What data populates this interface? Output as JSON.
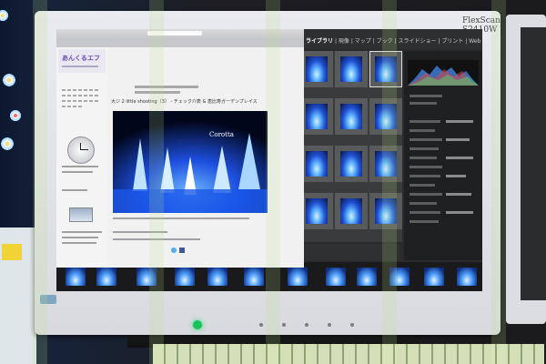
{
  "scene": {
    "monitor_brand": "FlexScan S2410W",
    "lightroom_menu": {
      "active": "ライブラリ",
      "items": [
        "現像",
        "マップ",
        "ブック",
        "スライドショー",
        "プリント",
        "Web"
      ]
    },
    "blog": {
      "site_title": "あんくるエフ",
      "post_title": "大ジ 2 little shooting（3） - チェック介表 & 恵比寿ガーデンプレイス",
      "photo_caption": "Corotta"
    },
    "bezel_controls": [
      "",
      "",
      "",
      "",
      ""
    ],
    "colors": {
      "bezel": "#e2e4e7",
      "screen_dark": "#2a2b2d",
      "illumination_blue": "#2f78ff",
      "power_led": "#19c25b",
      "blog_accent": "#6d47b8"
    }
  }
}
